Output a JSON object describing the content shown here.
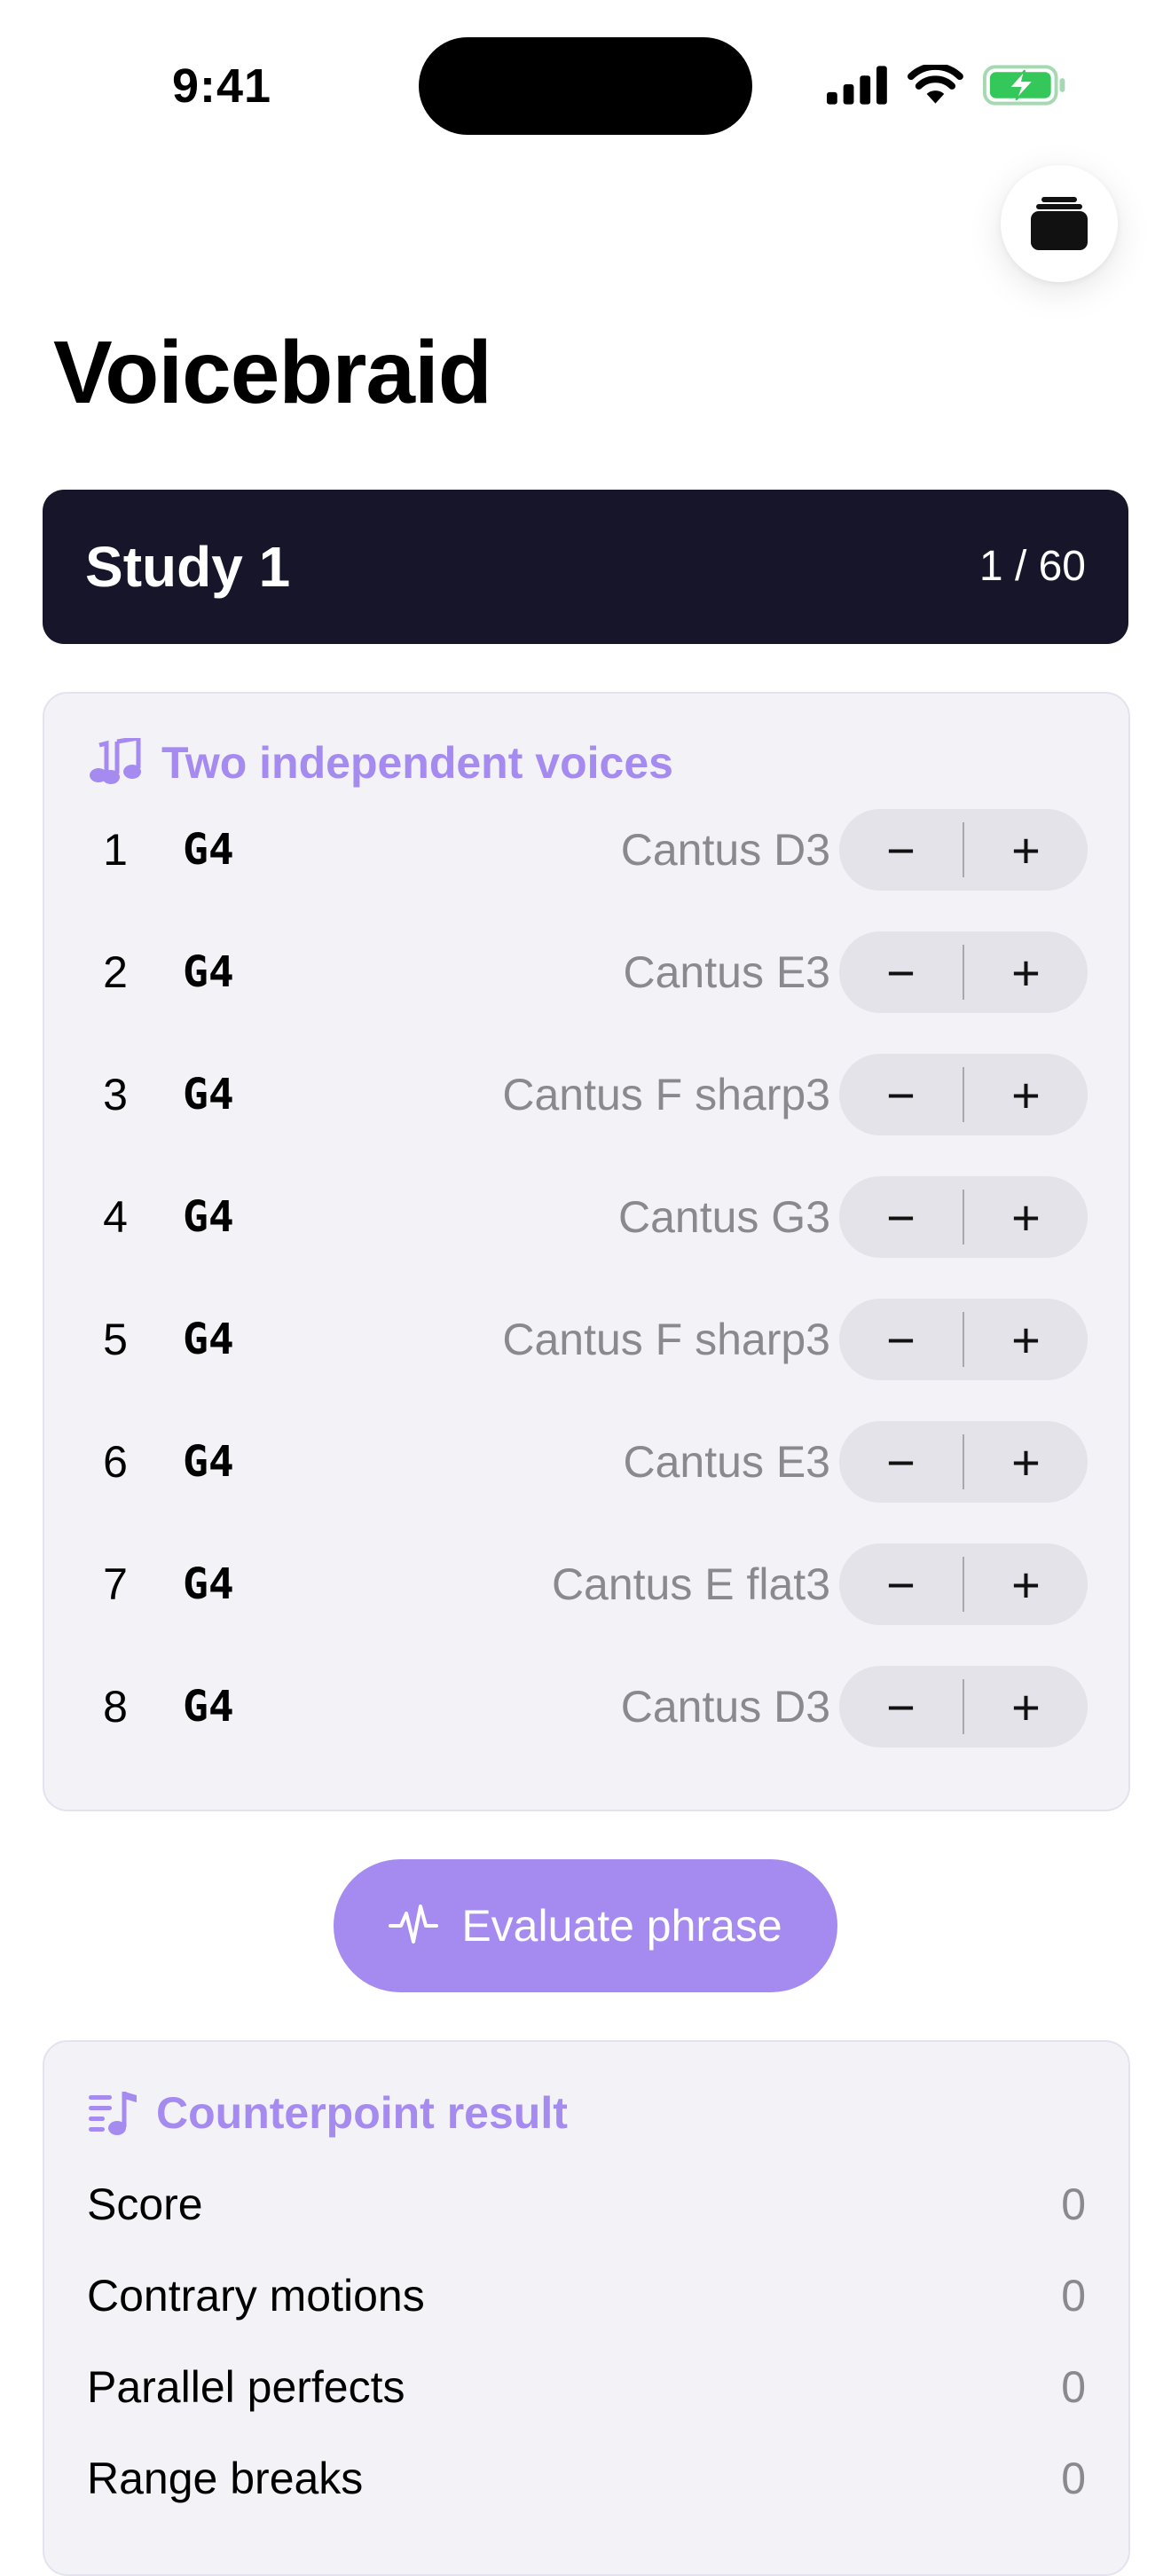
{
  "status_bar": {
    "time": "9:41"
  },
  "header": {
    "title": "Voicebraid",
    "stack_button_icon": "stack-icon"
  },
  "study": {
    "title": "Study 1",
    "count": "1 / 60"
  },
  "voices_card": {
    "header_icon": "music-notes-icon",
    "header": "Two independent voices",
    "rows": [
      {
        "num": "1",
        "note": "G4",
        "cantus": "Cantus D3"
      },
      {
        "num": "2",
        "note": "G4",
        "cantus": "Cantus E3"
      },
      {
        "num": "3",
        "note": "G4",
        "cantus": "Cantus F sharp3"
      },
      {
        "num": "4",
        "note": "G4",
        "cantus": "Cantus G3"
      },
      {
        "num": "5",
        "note": "G4",
        "cantus": "Cantus F sharp3"
      },
      {
        "num": "6",
        "note": "G4",
        "cantus": "Cantus E3"
      },
      {
        "num": "7",
        "note": "G4",
        "cantus": "Cantus E flat3"
      },
      {
        "num": "8",
        "note": "G4",
        "cantus": "Cantus D3"
      }
    ],
    "minus_label": "−",
    "plus_label": "+"
  },
  "evaluate_button": {
    "icon": "waveform-icon",
    "label": "Evaluate phrase"
  },
  "result_card": {
    "header_icon": "music-list-icon",
    "header": "Counterpoint result",
    "rows": [
      {
        "label": "Score",
        "value": "0"
      },
      {
        "label": "Contrary motions",
        "value": "0"
      },
      {
        "label": "Parallel perfects",
        "value": "0"
      },
      {
        "label": "Range breaks",
        "value": "0"
      }
    ]
  },
  "colors": {
    "accent": "#a58af0",
    "banner": "#16152a",
    "card_bg": "#f2f2f7",
    "secondary_text": "#8a8a8e",
    "battery": "#34c759"
  }
}
